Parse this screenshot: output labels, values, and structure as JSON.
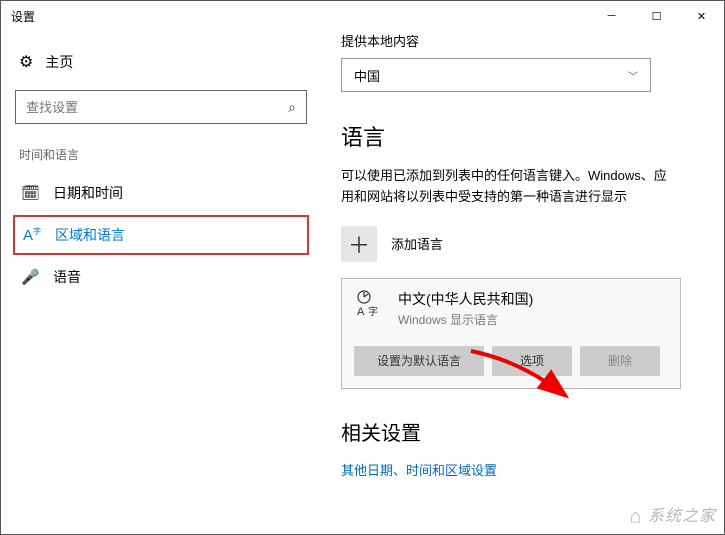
{
  "window": {
    "title": "设置"
  },
  "sidebar": {
    "home": "主页",
    "search_placeholder": "查找设置",
    "section": "时间和语言",
    "items": [
      {
        "label": "日期和时间"
      },
      {
        "label": "区域和语言"
      },
      {
        "label": "语音"
      }
    ]
  },
  "content": {
    "country_label": "提供本地内容",
    "country_value": "中国",
    "lang_heading": "语言",
    "lang_desc": "可以使用已添加到列表中的任何语言键入。Windows、应用和网站将以列表中受支持的第一种语言进行显示",
    "add_lang": "添加语言",
    "lang_item": {
      "name": "中文(中华人民共和国)",
      "sub": "Windows 显示语言",
      "btn_default": "设置为默认语言",
      "btn_options": "选项",
      "btn_remove": "删除"
    },
    "related_heading": "相关设置",
    "related_link": "其他日期、时间和区域设置"
  },
  "watermark": "系统之家"
}
